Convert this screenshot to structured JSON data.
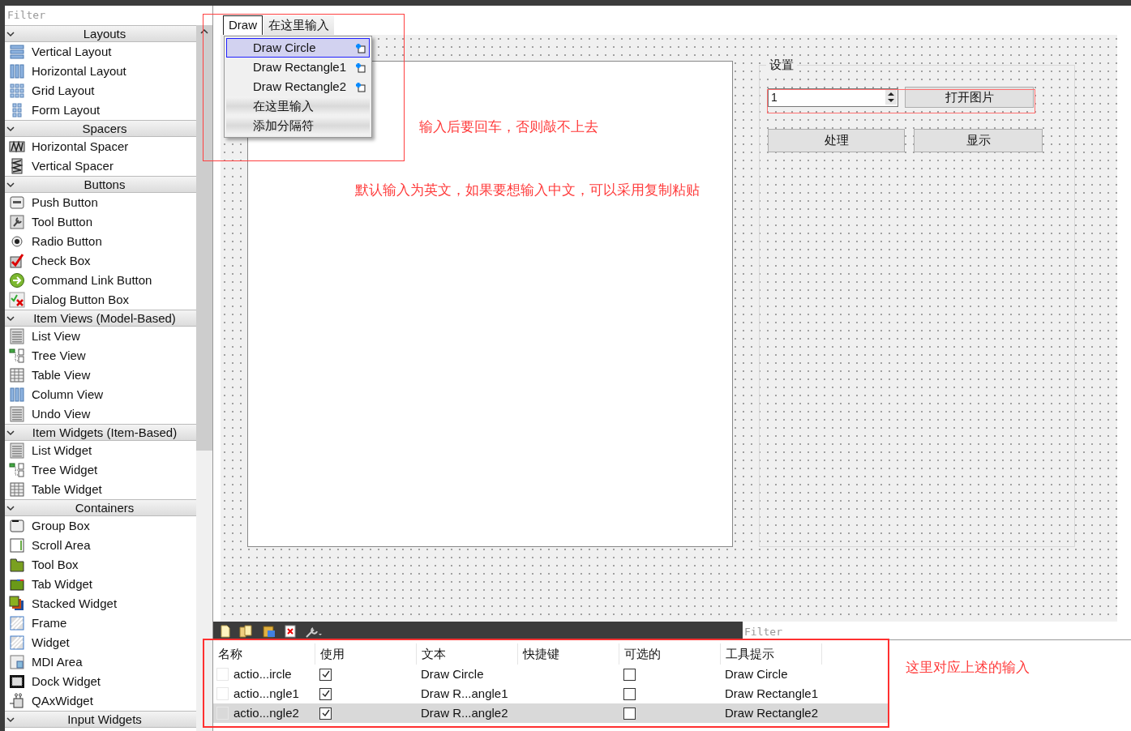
{
  "widget_box": {
    "filter_placeholder": "Filter",
    "sections": [
      {
        "title": "Layouts",
        "expanded": true,
        "items": [
          "Vertical Layout",
          "Horizontal Layout",
          "Grid Layout",
          "Form Layout"
        ]
      },
      {
        "title": "Spacers",
        "expanded": true,
        "items": [
          "Horizontal Spacer",
          "Vertical Spacer"
        ]
      },
      {
        "title": "Buttons",
        "expanded": true,
        "items": [
          "Push Button",
          "Tool Button",
          "Radio Button",
          "Check Box",
          "Command Link Button",
          "Dialog Button Box"
        ]
      },
      {
        "title": "Item Views (Model-Based)",
        "expanded": true,
        "items": [
          "List View",
          "Tree View",
          "Table View",
          "Column View",
          "Undo View"
        ]
      },
      {
        "title": "Item Widgets (Item-Based)",
        "expanded": true,
        "items": [
          "List Widget",
          "Tree Widget",
          "Table Widget"
        ]
      },
      {
        "title": "Containers",
        "expanded": true,
        "items": [
          "Group Box",
          "Scroll Area",
          "Tool Box",
          "Tab Widget",
          "Stacked Widget",
          "Frame",
          "Widget",
          "MDI Area",
          "Dock Widget",
          "QAxWidget"
        ]
      },
      {
        "title": "Input Widgets",
        "expanded": true
      }
    ]
  },
  "form": {
    "menu_bar": [
      {
        "label": "Draw",
        "selected": true
      },
      {
        "label": "在这里输入",
        "selected": false
      }
    ],
    "menu_items": [
      {
        "label": "Draw Circle",
        "kind": "action",
        "selected": true
      },
      {
        "label": "Draw Rectangle1",
        "kind": "action",
        "selected": false
      },
      {
        "label": "Draw Rectangle2",
        "kind": "action",
        "selected": false
      },
      {
        "label": "在这里输入",
        "kind": "placeholder",
        "selected": false
      },
      {
        "label": "添加分隔符",
        "kind": "placeholder",
        "selected": false
      }
    ],
    "group_box": {
      "title": "设置",
      "spin_value": "1",
      "open_button": "打开图片",
      "buttons": [
        "处理",
        "显示"
      ]
    }
  },
  "action_editor": {
    "filter_placeholder": "Filter",
    "columns": [
      "名称",
      "使用",
      "文本",
      "快捷键",
      "可选的",
      "工具提示"
    ],
    "rows": [
      {
        "name": "actio...ircle",
        "used": true,
        "text": "Draw Circle",
        "checkable": false,
        "tooltip": "Draw Circle",
        "selected": false
      },
      {
        "name": "actio...ngle1",
        "used": true,
        "text": "Draw R...angle1",
        "checkable": false,
        "tooltip": "Draw Rectangle1",
        "selected": false
      },
      {
        "name": "actio...ngle2",
        "used": true,
        "text": "Draw R...angle2",
        "checkable": false,
        "tooltip": "Draw Rectangle2",
        "selected": true
      }
    ]
  },
  "annotations": [
    "输入后要回车，否则敲不上去",
    "默认输入为英文，如果要想输入中文，可以采用复制粘贴",
    "这里对应上述的输入"
  ]
}
